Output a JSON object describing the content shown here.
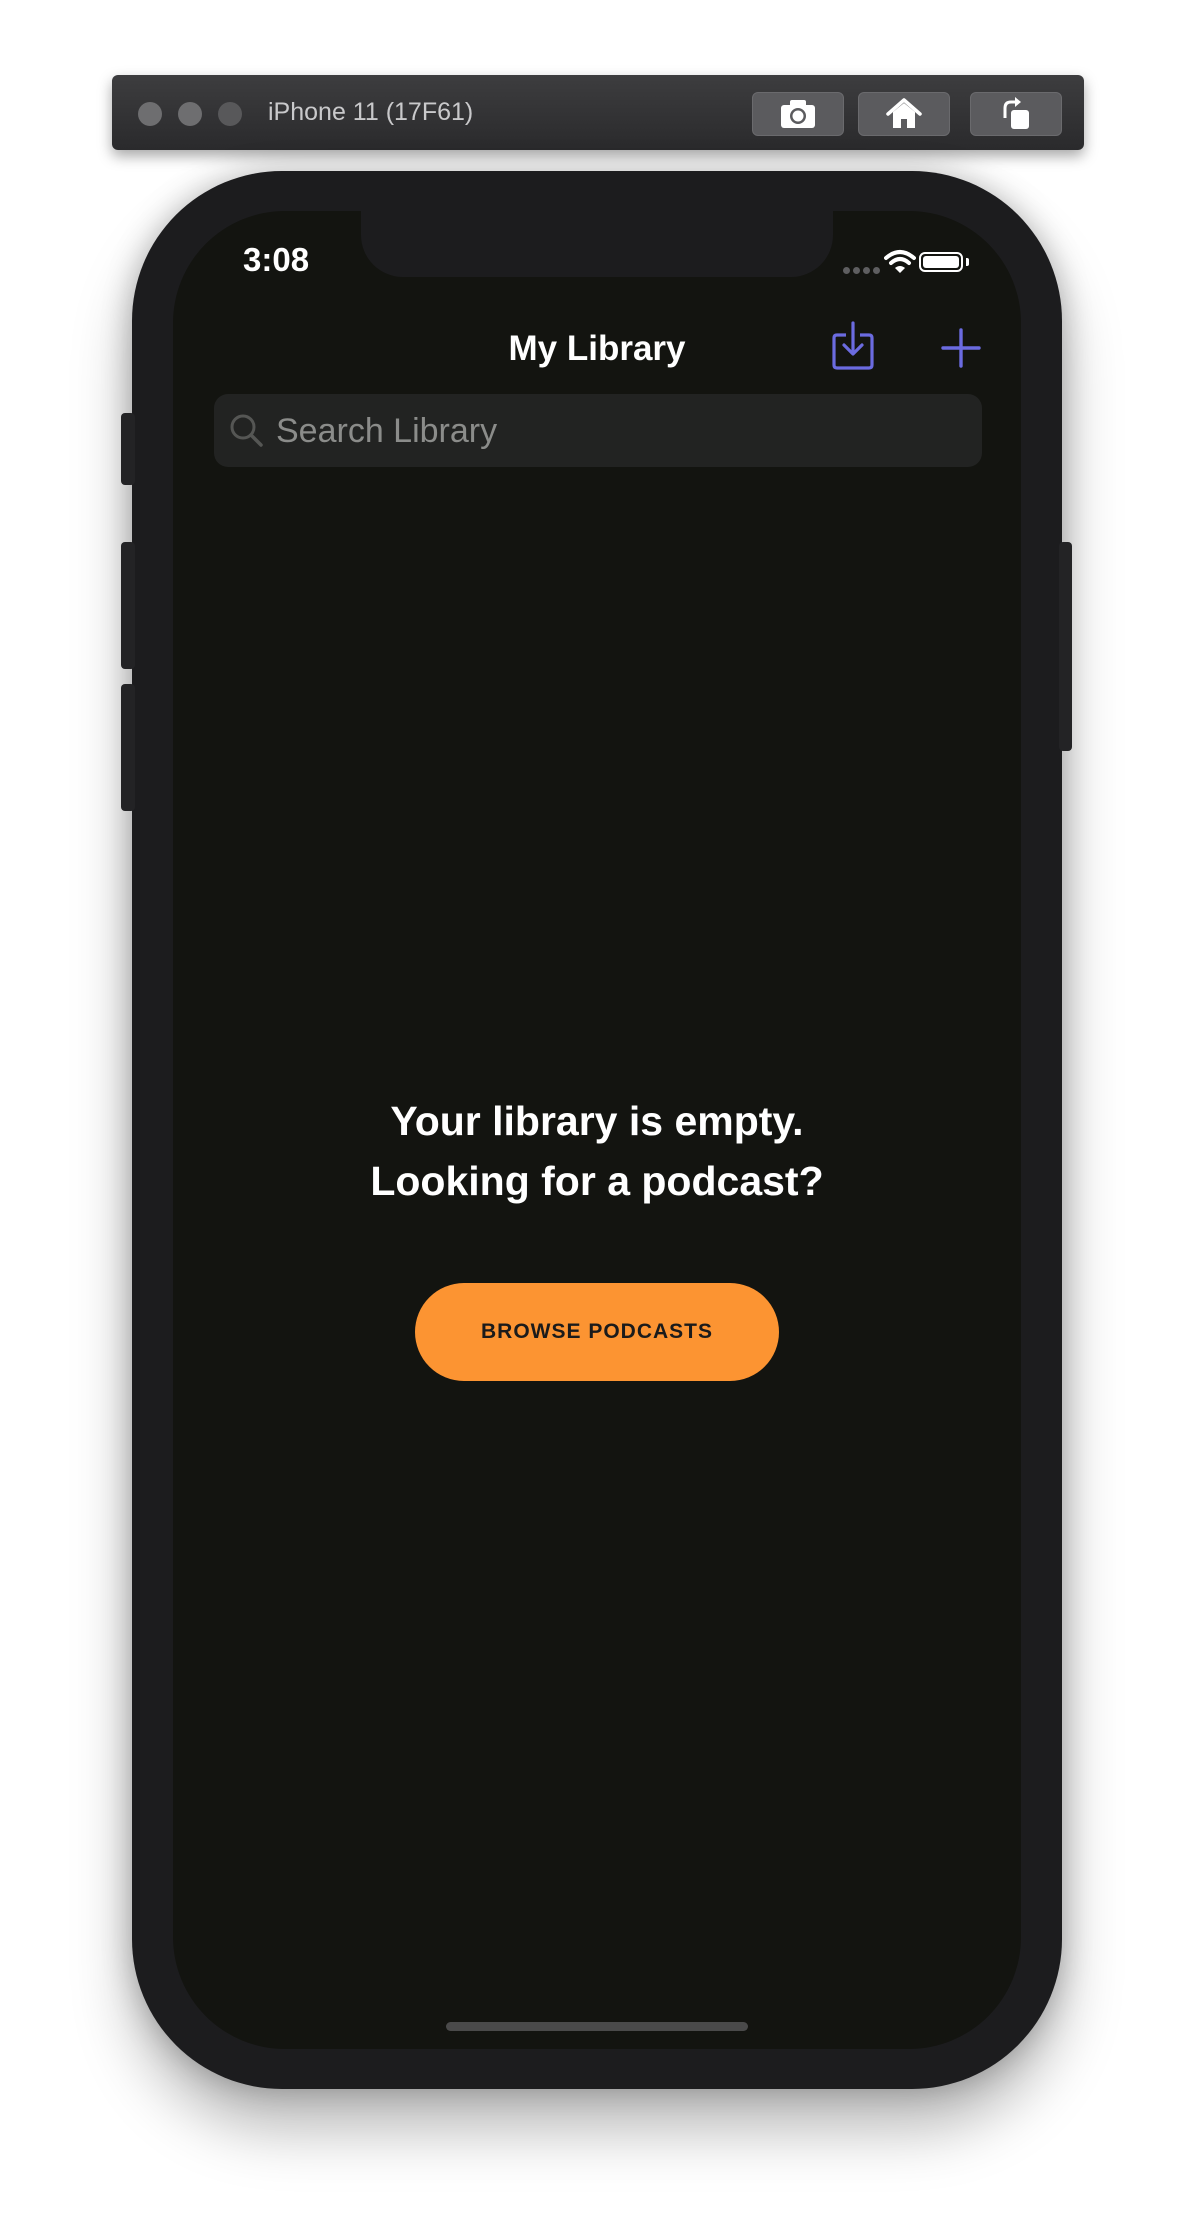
{
  "simulator": {
    "device_title": "iPhone 11 (17F61)",
    "buttons": [
      "screenshot-icon",
      "home-icon",
      "rotate-icon"
    ]
  },
  "status_bar": {
    "time": "3:08",
    "icons": [
      "cellular-signal-icon",
      "wifi-icon",
      "battery-icon"
    ]
  },
  "nav": {
    "title": "My Library",
    "actions": [
      "download-tray-icon",
      "plus-icon"
    ]
  },
  "search": {
    "placeholder": "Search Library",
    "value": ""
  },
  "empty_state": {
    "line1": "Your library is empty.",
    "line2": "Looking for a podcast?",
    "button_label": "BROWSE PODCASTS"
  },
  "colors": {
    "accent": "#6b6be0",
    "button": "#fc9432",
    "screen_background": "#131410"
  }
}
